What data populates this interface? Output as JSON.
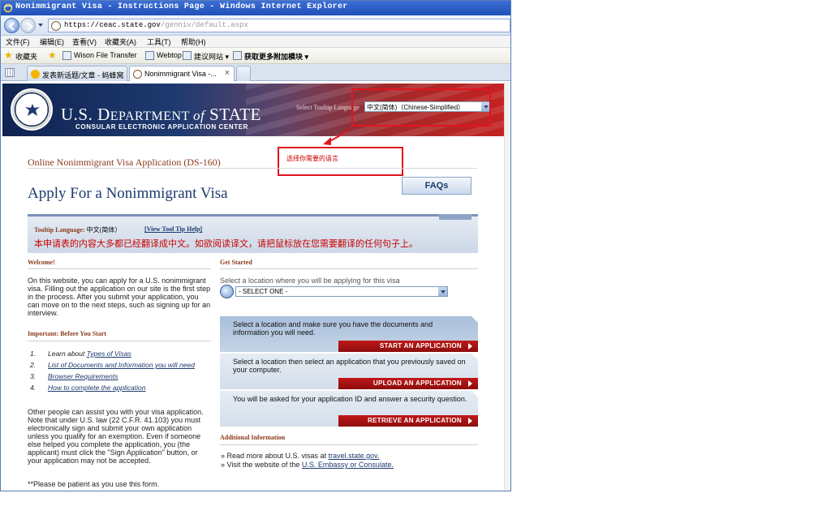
{
  "window": {
    "title": "Nonimmigrant Visa - Instructions Page - Windows Internet Explorer",
    "url_host": "https://ceac.state.gov",
    "url_path": "/genniv/default.aspx"
  },
  "menu": [
    "文件(F)",
    "编辑(E)",
    "查看(V)",
    "收藏夹(A)",
    "工具(T)",
    "帮助(H)"
  ],
  "favorites": {
    "label": "收藏夹",
    "items": [
      "Wison File Transfer",
      "Webtop",
      "建议网站 ▾",
      "获取更多附加模块 ▾"
    ]
  },
  "tabs": [
    {
      "label": "发表新话题/文章 - 蚂蜂窝"
    },
    {
      "label": "Nonimmigrant Visa -..."
    }
  ],
  "banner": {
    "dept_prefix": "U.S. D",
    "dept_main": "EPARTMENT ",
    "dept_of": "of",
    "dept_state": " STATE",
    "subtitle": "CONSULAR ELECTRONIC APPLICATION CENTER",
    "tooltip_lang_label": "Select Tooltip Language",
    "tooltip_lang_value": "中文(简体)（Chinese-Simplified）"
  },
  "annotation": {
    "text": "选择你需要的语言"
  },
  "header": {
    "app_label": "Online Nonimmigrant Visa Application (DS-160)",
    "title": "Apply For a Nonimmigrant Visa",
    "faq_label": "FAQs"
  },
  "tooltip_panel": {
    "label": "Tooltip Language:",
    "value": "中文(简体）",
    "help_link": "[View Tool Tip Help]",
    "message": "本申请表的内容大多都已经翻译成中文。如欲阅读译文，请把鼠标放在您需要翻译的任何句子上。"
  },
  "welcome": {
    "heading": "Welcome!",
    "text": "On this website, you can apply for a U.S. nonimmigrant visa. Filling out the application on our site is the first step in the process. After you submit your application, you can move on to the next steps, such as signing up for an interview."
  },
  "important": {
    "heading": "Important: Before You Start",
    "steps": [
      {
        "num": "1.",
        "prefix": "Learn about ",
        "link": "Types of Visas"
      },
      {
        "num": "2.",
        "prefix": "",
        "link": "List of Documents and Information you will need"
      },
      {
        "num": "3.",
        "prefix": "",
        "link": "Browser Requirements"
      },
      {
        "num": "4.",
        "prefix": "",
        "link": "How to complete the application"
      }
    ],
    "note": "Other people can assist you with your visa application. Note that under U.S. law (22 C.F.R. 41.103) you must electronically sign and submit your own application unless you qualify for an exemption. Even if someone else helped you complete the application, you (the applicant) must click the \"Sign Application\" button, or your application may not be accepted.",
    "patience": "**Please be patient as you use this form."
  },
  "get_started": {
    "heading": "Get Started",
    "location_label": "Select a location where you will be applying for this visa",
    "location_value": "- SELECT ONE -",
    "actions": [
      {
        "text": "Select a location and make sure you have the documents and information you will need.",
        "button": "START AN APPLICATION"
      },
      {
        "text": "Select a location then select an application that you previously saved on your computer.",
        "button": "UPLOAD AN APPLICATION"
      },
      {
        "text": "You will be asked for your application ID and answer a security question.",
        "button": "RETRIEVE AN APPLICATION"
      }
    ]
  },
  "additional": {
    "heading": "Additional Information",
    "line1_prefix": "» Read more about U.S. visas at ",
    "line1_link": "travel.state.gov.",
    "line2_prefix": "» Visit the website of the ",
    "line2_link": "U.S. Embassy or Consulate."
  }
}
